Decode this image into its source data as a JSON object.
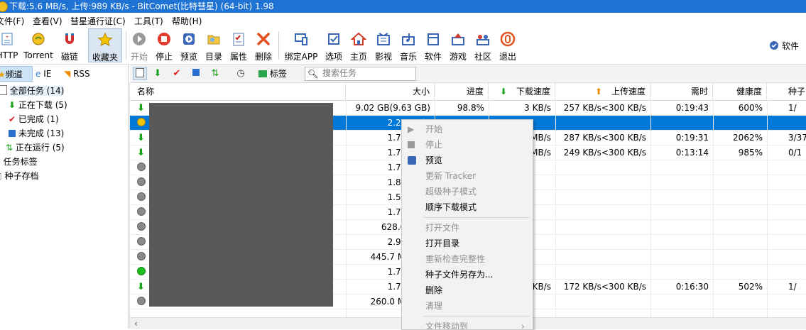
{
  "title": "下载:5.6 MB/s, 上传:989 KB/s - BitComet(比特彗星) (64-bit) 1.98",
  "menu": [
    "文件(F)",
    "查看(V)",
    "彗星通行证(C)",
    "工具(T)",
    "帮助(H)"
  ],
  "toolbar": {
    "items": [
      {
        "label": "HTTP",
        "icon": "http-add-icon"
      },
      {
        "label": "Torrent",
        "icon": "torrent-add-icon"
      },
      {
        "label": "磁链",
        "icon": "magnet-icon"
      },
      {
        "label": "收藏夹",
        "icon": "favorites-star-icon"
      },
      {
        "label": "开始",
        "icon": "start-icon"
      },
      {
        "label": "停止",
        "icon": "stop-icon"
      },
      {
        "label": "预览",
        "icon": "preview-icon"
      },
      {
        "label": "目录",
        "icon": "folder-icon"
      },
      {
        "label": "属性",
        "icon": "properties-icon"
      },
      {
        "label": "删除",
        "icon": "delete-icon"
      },
      {
        "label": "绑定APP",
        "icon": "bind-app-icon"
      },
      {
        "label": "选项",
        "icon": "options-icon"
      },
      {
        "label": "主页",
        "icon": "home-icon"
      },
      {
        "label": "影视",
        "icon": "movies-icon"
      },
      {
        "label": "音乐",
        "icon": "music-icon"
      },
      {
        "label": "软件",
        "icon": "software-icon"
      },
      {
        "label": "游戏",
        "icon": "games-icon"
      },
      {
        "label": "社区",
        "icon": "community-icon"
      },
      {
        "label": "退出",
        "icon": "exit-icon"
      }
    ],
    "right_label": "软件"
  },
  "left": {
    "tabs": [
      "频道",
      "IE",
      "RSS"
    ],
    "tree": [
      {
        "label": "全部任务 (14)"
      },
      {
        "label": "正在下载 (5)"
      },
      {
        "label": "已完成 (1)"
      },
      {
        "label": "未完成 (13)"
      },
      {
        "label": "正在运行 (5)"
      },
      {
        "label": "任务标签"
      },
      {
        "label": "种子存档"
      }
    ]
  },
  "tb2": {
    "tag_label": "标签",
    "search_placeholder": "搜索任务"
  },
  "table": {
    "headers": [
      "名称",
      "大小",
      "进度",
      "下载速度",
      "上传速度",
      "需时",
      "健康度",
      "种子"
    ],
    "rows": [
      {
        "status": "downloading",
        "size": "9.02 GB(9.63 GB)",
        "progress": "98.8%",
        "down": "3 KB/s",
        "up": "257 KB/s<300 KB/s",
        "eta": "0:19:43",
        "health": "600%",
        "seeds": "1/"
      },
      {
        "status": "paused-yellow",
        "size": "2.22 GB(3",
        "progress": "",
        "down": "",
        "up": "",
        "eta": "",
        "health": "",
        "seeds": ""
      },
      {
        "status": "downloading",
        "size": "1.76 GB(2",
        "progress": "",
        "down": "MB/s",
        "up": "287 KB/s<300 KB/s",
        "eta": "0:19:31",
        "health": "2062%",
        "seeds": "3/37"
      },
      {
        "status": "downloading",
        "size": "1.73 GB(2",
        "progress": "",
        "down": "MB/s",
        "up": "249 KB/s<300 KB/s",
        "eta": "0:13:14",
        "health": "985%",
        "seeds": "0/1"
      },
      {
        "status": "stopped",
        "size": "1.73 GB(2",
        "progress": "",
        "down": "",
        "up": "",
        "eta": "",
        "health": "",
        "seeds": ""
      },
      {
        "status": "stopped",
        "size": "1.83 GB(2",
        "progress": "",
        "down": "",
        "up": "",
        "eta": "",
        "health": "",
        "seeds": ""
      },
      {
        "status": "stopped",
        "size": "1.57 GB(2",
        "progress": "",
        "down": "",
        "up": "",
        "eta": "",
        "health": "",
        "seeds": ""
      },
      {
        "status": "stopped",
        "size": "1.73 GB(2",
        "progress": "",
        "down": "",
        "up": "",
        "eta": "",
        "health": "",
        "seeds": ""
      },
      {
        "status": "stopped",
        "size": "628.0 MB(1",
        "progress": "",
        "down": "",
        "up": "",
        "eta": "",
        "health": "",
        "seeds": ""
      },
      {
        "status": "stopped",
        "size": "2.92 GB(3",
        "progress": "",
        "down": "",
        "up": "",
        "eta": "",
        "health": "",
        "seeds": ""
      },
      {
        "status": "stopped",
        "size": "445.7 MB(635",
        "progress": "",
        "down": "",
        "up": "",
        "eta": "",
        "health": "",
        "seeds": ""
      },
      {
        "status": "completed",
        "size": "1.76 GB(2",
        "progress": "",
        "down": "",
        "up": "",
        "eta": "",
        "health": "",
        "seeds": ""
      },
      {
        "status": "downloading",
        "size": "1.73 GB(2",
        "progress": "",
        "down": "KB/s",
        "up": "172 KB/s<300 KB/s",
        "eta": "0:16:30",
        "health": "502%",
        "seeds": "1/"
      },
      {
        "status": "stopped",
        "size": "260.0 MB(638",
        "progress": "",
        "down": "",
        "up": "",
        "eta": "",
        "health": "",
        "seeds": ""
      }
    ]
  },
  "context_menu": [
    {
      "label": "开始",
      "enabled": false,
      "icon": "play-icon"
    },
    {
      "label": "停止",
      "enabled": false,
      "icon": "stop-square-icon"
    },
    {
      "label": "预览",
      "enabled": true,
      "icon": "preview-icon"
    },
    {
      "label": "更新 Tracker",
      "enabled": false
    },
    {
      "label": "超级种子模式",
      "enabled": false
    },
    {
      "label": "顺序下载模式",
      "enabled": true
    },
    {
      "sep": true
    },
    {
      "label": "打开文件",
      "enabled": false
    },
    {
      "label": "打开目录",
      "enabled": true
    },
    {
      "label": "重新检查完整性",
      "enabled": false
    },
    {
      "label": "种子文件另存为...",
      "enabled": true
    },
    {
      "label": "删除",
      "enabled": true
    },
    {
      "label": "清理",
      "enabled": false
    },
    {
      "sep": true
    },
    {
      "label": "文件移动到",
      "enabled": false,
      "submenu": true
    }
  ]
}
